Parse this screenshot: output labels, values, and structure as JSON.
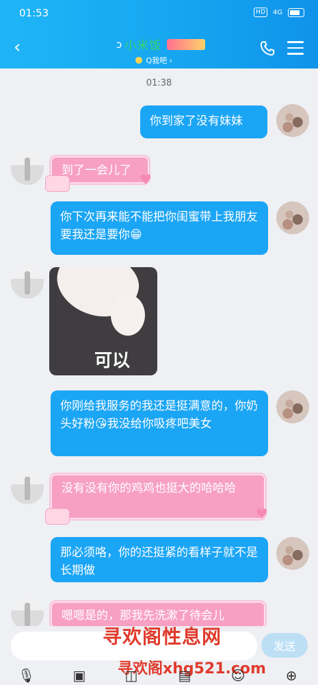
{
  "status_bar": {
    "time": "01:53",
    "hd": "HD",
    "network": "4G"
  },
  "header": {
    "back": "‹",
    "title": "小米饭",
    "subtitle": "Q我吧 ›",
    "phone_icon": "phone-icon",
    "menu_icon": "menu-icon"
  },
  "timestamp": "01:38",
  "messages": [
    {
      "dir": "out",
      "text": "你到家了没有妹妹"
    },
    {
      "dir": "in",
      "text": "到了一会儿了"
    },
    {
      "dir": "out",
      "text": "你下次再来能不能把你闺蜜带上我朋友要我还是要你😁"
    },
    {
      "dir": "in",
      "type": "image",
      "caption": "可以"
    },
    {
      "dir": "out",
      "text": "你刚给我服务的我还是挺满意的，你奶头好粉😘我没给你吸疼吧美女"
    },
    {
      "dir": "in",
      "text": "没有没有你的鸡鸡也挺大的哈哈哈"
    },
    {
      "dir": "out",
      "text": "那必须咯，你的还挺紧的看样子就不是长期做"
    },
    {
      "dir": "in",
      "text": "嗯嗯是的，那我先洗漱了待会儿"
    }
  ],
  "watermark": {
    "line1": "寻欢阁性息网",
    "line2": "寻欢阁xhg521.com"
  },
  "composer": {
    "input_value": "",
    "send_label": "发送"
  },
  "toolbar": [
    "mic-icon",
    "image-icon",
    "camera-icon",
    "redpacket-icon",
    "emoji-icon",
    "plus-icon"
  ],
  "colors": {
    "header": "#16a6f0",
    "out_bubble": "#1ba5f5",
    "in_bubble": "#f7a0c4",
    "watermark": "#e03b2c"
  }
}
